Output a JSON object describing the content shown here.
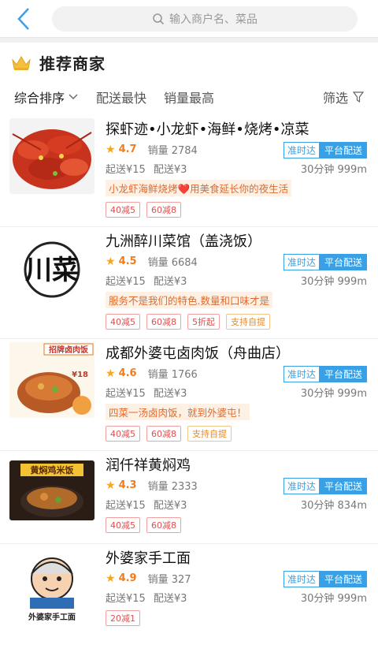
{
  "header": {
    "back_icon": "back-chevron-icon",
    "search_placeholder": "输入商户名、菜品",
    "search_icon": "search-icon"
  },
  "section": {
    "title": "推荐商家",
    "icon": "crown-icon"
  },
  "sort": {
    "items": [
      "综合排序",
      "配送最快",
      "销量最高"
    ],
    "active": "综合排序",
    "filter_label": "筛选",
    "filter_icon": "filter-funnel-icon"
  },
  "colors": {
    "accent_blue": "#3aa0e6",
    "star": "#f5a623",
    "rating": "#f07c1d"
  },
  "shops": [
    {
      "name": "探虾迹•小龙虾•海鲜•烧烤•凉菜",
      "rating": "4.7",
      "sales": "销量 2784",
      "min_order": "起送¥15",
      "delivery_fee": "配送¥3",
      "badge1": "准时达",
      "badge2": "平台配送",
      "time_distance": "30分钟 999m",
      "desc": "小龙虾海鲜烧烤❤️用美食延长你的夜生活",
      "tags": [
        {
          "text": "40减5",
          "style": "red"
        },
        {
          "text": "60减8",
          "style": "red"
        }
      ]
    },
    {
      "name": "九洲醉川菜馆（盖浇饭）",
      "rating": "4.5",
      "sales": "销量 6684",
      "min_order": "起送¥15",
      "delivery_fee": "配送¥3",
      "badge1": "准时达",
      "badge2": "平台配送",
      "time_distance": "30分钟 999m",
      "desc": "服务不是我们的特色.数量和口味才是",
      "tags": [
        {
          "text": "40减5",
          "style": "red"
        },
        {
          "text": "60减8",
          "style": "red"
        },
        {
          "text": "5折起",
          "style": "red"
        },
        {
          "text": "支持自提",
          "style": "orange"
        }
      ]
    },
    {
      "name": "成都外婆屯卤肉饭（舟曲店）",
      "rating": "4.6",
      "sales": "销量 1766",
      "min_order": "起送¥15",
      "delivery_fee": "配送¥3",
      "badge1": "准时达",
      "badge2": "平台配送",
      "time_distance": "30分钟 999m",
      "desc": "四菜一汤卤肉饭，就到外婆屯！",
      "tags": [
        {
          "text": "40减5",
          "style": "red"
        },
        {
          "text": "60减8",
          "style": "red"
        },
        {
          "text": "支持自提",
          "style": "orange"
        }
      ]
    },
    {
      "name": "润仟祥黄焖鸡",
      "rating": "4.3",
      "sales": "销量 2333",
      "min_order": "起送¥15",
      "delivery_fee": "配送¥3",
      "badge1": "准时达",
      "badge2": "平台配送",
      "time_distance": "30分钟 834m",
      "desc": "",
      "tags": [
        {
          "text": "40减5",
          "style": "red"
        },
        {
          "text": "60减8",
          "style": "red"
        }
      ]
    },
    {
      "name": "外婆家手工面",
      "rating": "4.9",
      "sales": "销量 327",
      "min_order": "起送¥15",
      "delivery_fee": "配送¥3",
      "badge1": "准时达",
      "badge2": "平台配送",
      "time_distance": "30分钟 999m",
      "desc": "",
      "tags": [
        {
          "text": "20减1",
          "style": "red"
        }
      ]
    }
  ],
  "thumb_texts": {
    "shop2_logo": "川菜",
    "shop3_banner": "招牌卤肉饭",
    "shop3_price": "¥18",
    "shop4_banner": "黄焖鸡米饭",
    "shop5_caption": "外婆家手工面"
  }
}
